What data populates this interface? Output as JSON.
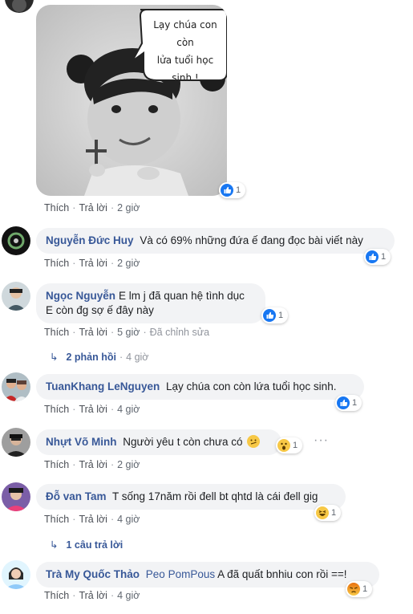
{
  "meme": {
    "speech_text": "Lạy chúa con còn lửa tuổi học sinh !",
    "speech_line1": "Lạy chúa con còn",
    "speech_line2": "lửa tuổi học sinh !",
    "reaction_count": "1"
  },
  "comments": [
    {
      "author": "",
      "text": "",
      "actions": {
        "like": "Thích",
        "reply": "Trả lời",
        "time": "2 giờ"
      }
    },
    {
      "author": "Nguyễn Đức Huy",
      "text": "Và có 69% những đứa ế đang đọc bài viết này",
      "reaction_count": "1",
      "actions": {
        "like": "Thích",
        "reply": "Trả lời",
        "time": "2 giờ"
      }
    },
    {
      "author": "Ngọc Nguyễn",
      "text_line1": "E lm j đã quan hệ tình dục",
      "text_line2": "E còn đg sợ ế đây này",
      "reaction_count": "1",
      "actions": {
        "like": "Thích",
        "reply": "Trả lời",
        "time": "5 giờ",
        "edited": "Đã chỉnh sửa"
      },
      "replies": {
        "count": "2 phản hồi",
        "time": "4 giờ"
      }
    },
    {
      "author": "TuanKhang LeNguyen",
      "text": "Lạy chúa con còn lứa tuổi học sinh.",
      "reaction_count": "1",
      "actions": {
        "like": "Thích",
        "reply": "Trả lời",
        "time": "4 giờ"
      }
    },
    {
      "author": "Nhựt Võ Minh",
      "text": "Người yêu t còn chưa có",
      "reaction_count": "1",
      "more": "···",
      "actions": {
        "like": "Thích",
        "reply": "Trả lời",
        "time": "2 giờ"
      }
    },
    {
      "author": "Đỗ van Tam",
      "text": "T sống 17năm rồi đell bt qhtd là cái đell gig",
      "reaction_count": "1",
      "actions": {
        "like": "Thích",
        "reply": "Trả lời",
        "time": "4 giờ"
      },
      "replies": {
        "count": "1 câu trả lời"
      }
    },
    {
      "author": "Trà My Quốc Thảo",
      "mention": "Peo PomPous",
      "text": "A đã quất bnhiu con rồi ==!",
      "reaction_count": "1",
      "actions": {
        "like": "Thích",
        "reply": "Trả lời",
        "time": "4 giờ"
      }
    }
  ],
  "colors": {
    "link_blue": "#385898",
    "bubble_bg": "#f2f3f5",
    "like_blue": "#1877f2",
    "wow_yellow": "#f7c846",
    "angry_orange": "#e9710f"
  }
}
